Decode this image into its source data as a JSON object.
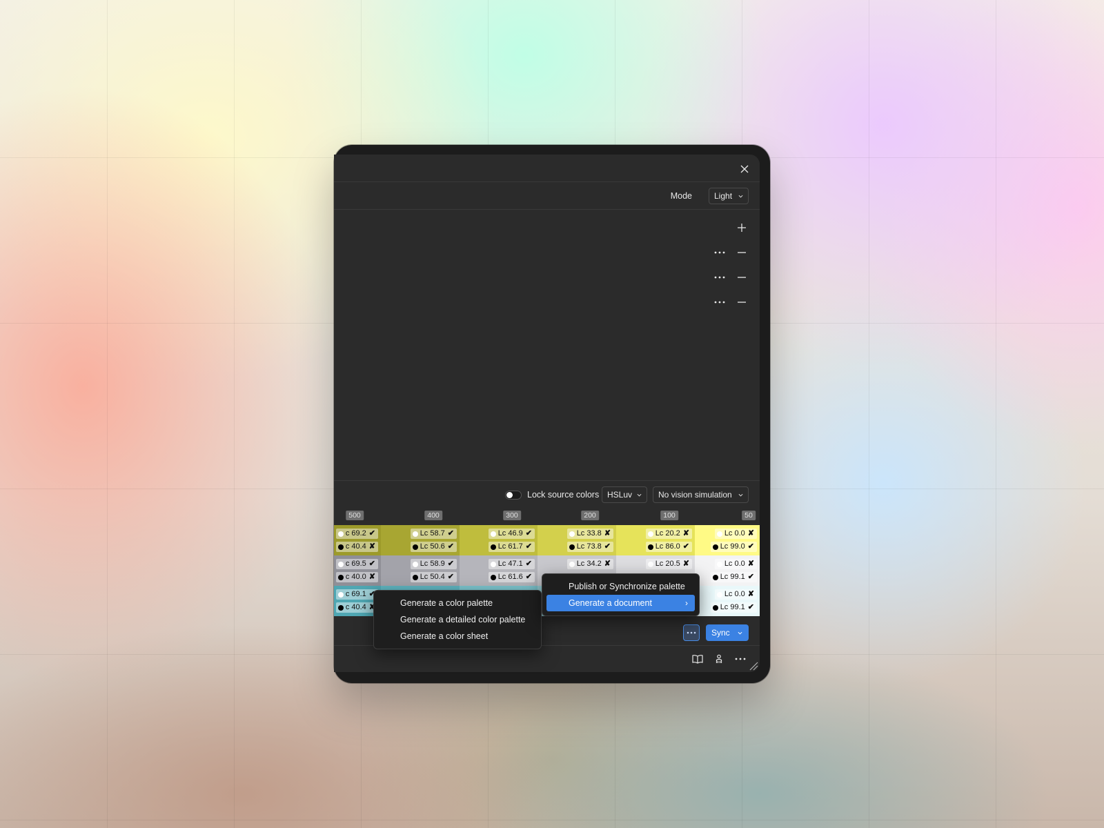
{
  "window": {
    "mode_label": "Mode",
    "mode_value": "Light"
  },
  "controls": {
    "lock_label": "Lock source colors",
    "lock_on": false,
    "color_space": "HSLuv",
    "vision": "No vision simulation"
  },
  "scale_labels": [
    "500",
    "400",
    "300",
    "200",
    "100",
    "50"
  ],
  "swatch_rows": [
    {
      "cells": [
        {
          "bg": "#9c9a2a",
          "light_text": "c 69.2",
          "light_mark": "✔",
          "dark_text": "c 40.4",
          "dark_mark": "✘"
        },
        {
          "bg": "#a8a632",
          "light_text": "Lc 58.7",
          "light_mark": "✔",
          "dark_text": "Lc 50.6",
          "dark_mark": "✔"
        },
        {
          "bg": "#bfbd3d",
          "light_text": "Lc 46.9",
          "light_mark": "✔",
          "dark_text": "Lc 61.7",
          "dark_mark": "✔"
        },
        {
          "bg": "#d3d04c",
          "light_text": "Lc 33.8",
          "light_mark": "✘",
          "dark_text": "Lc 73.8",
          "dark_mark": "✔"
        },
        {
          "bg": "#e6e35a",
          "light_text": "Lc 20.2",
          "light_mark": "✘",
          "dark_text": "Lc 86.0",
          "dark_mark": "✔"
        },
        {
          "bg": "#fffa85",
          "light_text": "Lc 0.0",
          "light_mark": "✘",
          "dark_text": "Lc 99.0",
          "dark_mark": "✔"
        }
      ]
    },
    {
      "cells": [
        {
          "bg": "#8f8f97",
          "light_text": "c 69.5",
          "light_mark": "✔",
          "dark_text": "c 40.0",
          "dark_mark": "✘"
        },
        {
          "bg": "#a3a3aa",
          "light_text": "Lc 58.9",
          "light_mark": "✔",
          "dark_text": "Lc 50.4",
          "dark_mark": "✔"
        },
        {
          "bg": "#b5b5bb",
          "light_text": "Lc 47.1",
          "light_mark": "✔",
          "dark_text": "Lc 61.6",
          "dark_mark": "✔"
        },
        {
          "bg": "#c8c8cd",
          "light_text": "Lc 34.2",
          "light_mark": "✘",
          "dark_text": "",
          "dark_mark": ""
        },
        {
          "bg": "#dddde0",
          "light_text": "Lc 20.5",
          "light_mark": "✘",
          "dark_text": "",
          "dark_mark": ""
        },
        {
          "bg": "#f3f3f4",
          "light_text": "Lc 0.0",
          "light_mark": "✘",
          "dark_text": "Lc 99.1",
          "dark_mark": "✔"
        }
      ]
    },
    {
      "cells": [
        {
          "bg": "#4fa7b3",
          "light_text": "c 69.1",
          "light_mark": "✔",
          "dark_text": "c 40.4",
          "dark_mark": "✘"
        },
        {
          "bg": "#5fb4bf",
          "light_text": "",
          "light_mark": "",
          "dark_text": "",
          "dark_mark": ""
        },
        {
          "bg": "#7cc4cd",
          "light_text": "",
          "light_mark": "",
          "dark_text": "",
          "dark_mark": ""
        },
        {
          "bg": "#9ad3da",
          "light_text": "",
          "light_mark": "",
          "dark_text": "",
          "dark_mark": ""
        },
        {
          "bg": "#bce3e8",
          "light_text": "",
          "light_mark": "",
          "dark_text": "",
          "dark_mark": ""
        },
        {
          "bg": "#e9f8fa",
          "light_text": "Lc 0.0",
          "light_mark": "✘",
          "dark_text": "Lc 99.1",
          "dark_mark": "✔"
        }
      ]
    }
  ],
  "footer": {
    "sync_label": "Sync"
  },
  "menu_left": {
    "items": [
      "Generate a color palette",
      "Generate a detailed color palette",
      "Generate a color sheet"
    ]
  },
  "menu_right": {
    "items": [
      "Publish or Synchronize palette",
      "Generate a document"
    ],
    "active_index": 1,
    "submenu_arrow": "›"
  },
  "colors": {
    "accent": "#3b82e3",
    "panel": "#2b2b2b",
    "frame": "#1c1c1c"
  },
  "icons": [
    "close-icon",
    "chevron-down-icon",
    "plus-icon",
    "more-icon",
    "minus-icon",
    "book-icon",
    "person-icon",
    "resize-grip-icon"
  ]
}
